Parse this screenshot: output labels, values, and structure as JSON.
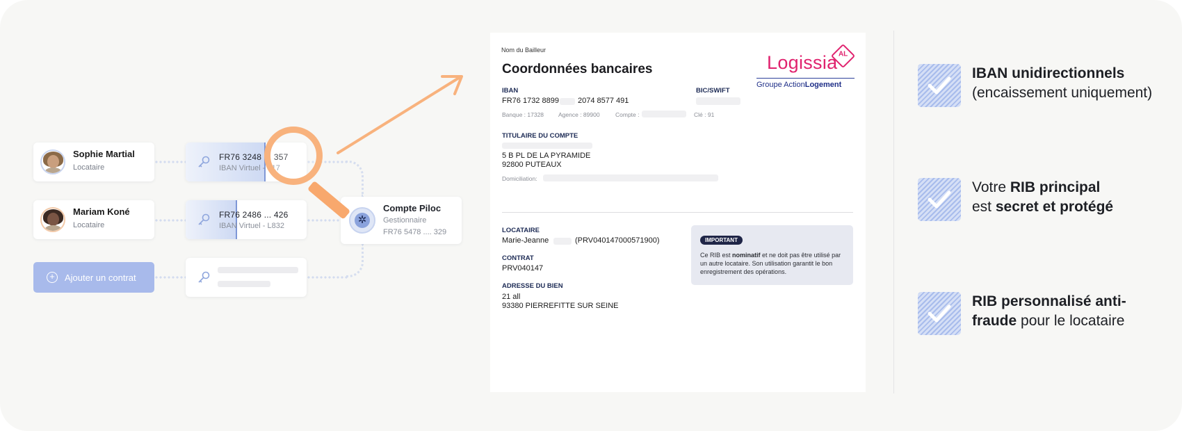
{
  "people": [
    {
      "name": "Sophie Martial",
      "role": "Locataire"
    },
    {
      "name": "Mariam Koné",
      "role": "Locataire"
    }
  ],
  "iban_cards": [
    {
      "line1": "FR76 3248 ... 357",
      "line2": "IBAN Virtuel - 417"
    },
    {
      "line1": "FR76 2486 ... 426",
      "line2": "IBAN Virtuel - L832"
    }
  ],
  "add_contract": {
    "label": "Ajouter un contrat"
  },
  "gestion": {
    "title": "Compte Piloc",
    "role": "Gestionnaire",
    "iban": "FR76 5478 .... 329"
  },
  "doc": {
    "bailleur": "Nom du Bailleur",
    "title": "Coordonnées bancaires",
    "brand": {
      "name": "Logissia",
      "badge": "AL",
      "group_prefix": "Groupe Action",
      "group_suffix": "Logement"
    },
    "iban_label": "IBAN",
    "iban_part1": "FR76 1732 8899",
    "iban_part2": "2074 8577 491",
    "bic_label": "BIC/SWIFT",
    "banque": "Banque : 17328",
    "agence": "Agence : 89900",
    "compte": "Compte :",
    "cle": "Clé : 91",
    "titulaire_label": "TITULAIRE DU COMPTE",
    "address1": "5 B PL DE LA PYRAMIDE",
    "address2": "92800 PUTEAUX",
    "domiciliation": "Domiciliation:",
    "locataire_label": "LOCATAIRE",
    "locataire_name": "Marie-Jeanne",
    "locataire_ref": "(PRV040147000571900)",
    "contrat_label": "CONTRAT",
    "contrat_value": "PRV040147",
    "adresse_label": "ADRESSE DU BIEN",
    "adresse1": "21 all",
    "adresse2": "93380 PIERREFITTE SUR SEINE",
    "important": {
      "tag": "IMPORTANT",
      "text_before": "Ce RIB est ",
      "text_bold": "nominatif",
      "text_after": " et ne doit pas être utilisé par un autre locataire. Son utilisation garantit le bon enregistrement des opérations."
    }
  },
  "features": [
    {
      "bold": "IBAN unidirectionnels",
      "normal": "(encaissement uniquement)"
    },
    {
      "pre": "Votre ",
      "bold1": "RIB principal",
      "mid": "est ",
      "bold2": "secret et protégé"
    },
    {
      "bold": "RIB personnalisé anti-",
      "bold2": "fraude",
      "normal": " pour le locataire"
    }
  ],
  "colors": {
    "accent": "#f8a86d",
    "brand_pink": "#e0226e",
    "brand_blue": "#1f2f88",
    "button": "#a8baeb"
  },
  "icons": [
    "key-icon",
    "plus-circle-icon",
    "magnifier-icon",
    "arrow-icon",
    "checkbox-icon",
    "avatar-icon"
  ]
}
